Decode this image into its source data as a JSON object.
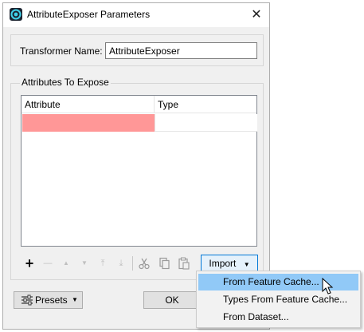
{
  "window": {
    "title": "AttributeExposer Parameters",
    "close_glyph": "✕"
  },
  "transformer": {
    "label": "Transformer Name:",
    "value": "AttributeExposer"
  },
  "attributes_group": {
    "title": "Attributes To Expose",
    "columns": [
      "Attribute",
      "Type"
    ],
    "rows": [
      {
        "attribute": "",
        "type": ""
      }
    ],
    "invalid_row_color": "#ff9797"
  },
  "toolbar": {
    "add_glyph": "+",
    "remove_glyph": "—",
    "move_up_glyph": "▲",
    "move_down_glyph": "▼",
    "move_top_glyph": "⤒",
    "move_bottom_glyph": "⤓",
    "cut_icon": "scissors-icon",
    "copy_icon": "copy-icon",
    "paste_icon": "paste-icon",
    "import_label": "Import",
    "dropdown_glyph": "▼"
  },
  "import_menu": {
    "items": [
      {
        "label": "From Feature Cache...",
        "highlighted": true
      },
      {
        "label": "Types From Feature Cache...",
        "highlighted": false
      },
      {
        "label": "From Dataset...",
        "highlighted": false
      }
    ],
    "highlight_color": "#91c9f7"
  },
  "footer": {
    "presets_label": "Presets",
    "presets_dropdown": "▼",
    "ok_label": "OK"
  },
  "colors": {
    "dialog_bg": "#f0f0f0",
    "accent": "#0078d7"
  }
}
